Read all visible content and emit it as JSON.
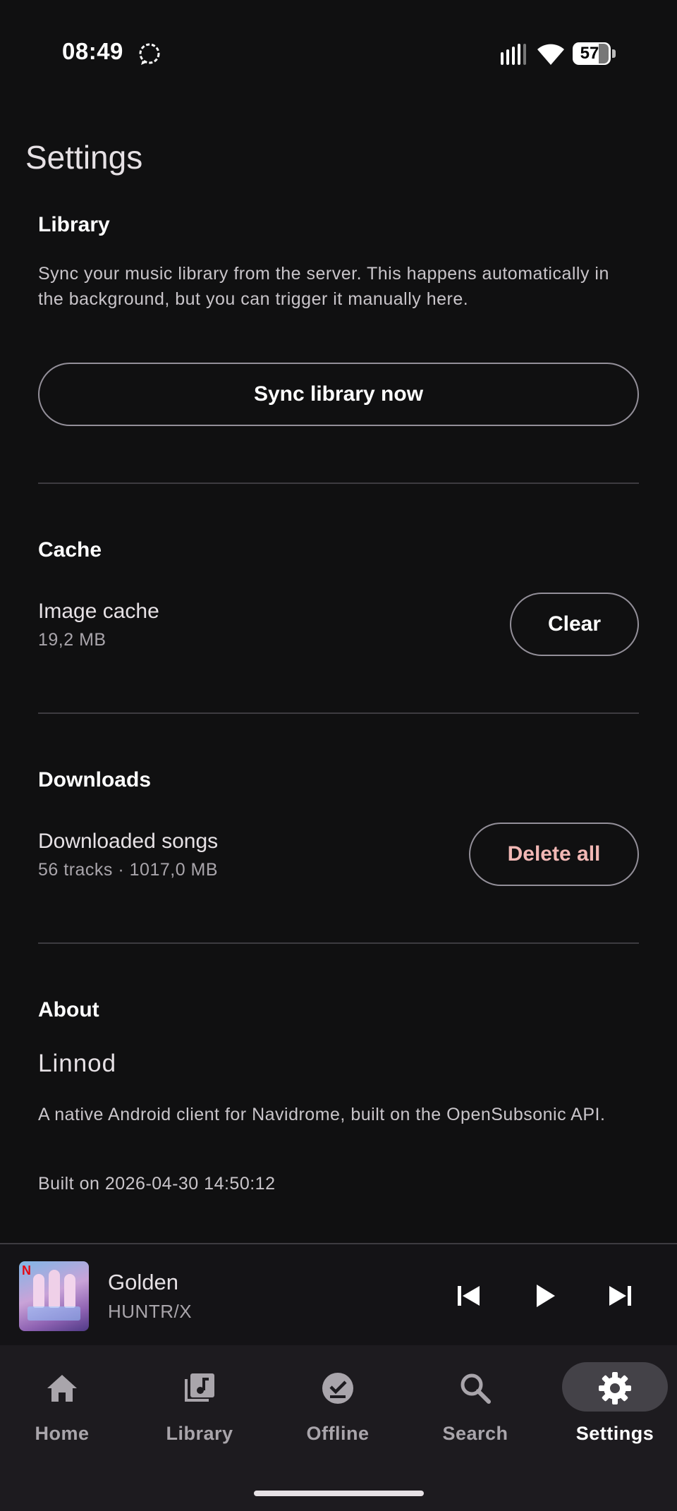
{
  "status_bar": {
    "time": "08:49",
    "battery": "57"
  },
  "page": {
    "title": "Settings"
  },
  "library": {
    "title": "Library",
    "description": "Sync your music library from the server. This happens automatically in the background, but you can trigger it manually here.",
    "sync_button": "Sync library now"
  },
  "cache": {
    "title": "Cache",
    "image_cache_label": "Image cache",
    "image_cache_size": "19,2 MB",
    "clear_button": "Clear"
  },
  "downloads": {
    "title": "Downloads",
    "label": "Downloaded songs",
    "summary": "56 tracks · 1017,0 MB",
    "delete_button": "Delete all"
  },
  "about": {
    "title": "About",
    "app_name": "Linnod",
    "description": "A native Android client for Navidrome, built on the OpenSubsonic API.",
    "build": "Built on 2026-04-30 14:50:12"
  },
  "player": {
    "title": "Golden",
    "artist": "HUNTR/X",
    "album_art_badge": "N",
    "icons": [
      "skip-previous-icon",
      "play-icon",
      "skip-next-icon"
    ]
  },
  "nav": {
    "items": [
      {
        "label": "Home",
        "icon": "home-icon",
        "active": false
      },
      {
        "label": "Library",
        "icon": "library-music-icon",
        "active": false
      },
      {
        "label": "Offline",
        "icon": "offline-check-icon",
        "active": false
      },
      {
        "label": "Search",
        "icon": "search-icon",
        "active": false
      },
      {
        "label": "Settings",
        "icon": "gear-icon",
        "active": true
      }
    ]
  },
  "colors": {
    "background": "#101011",
    "danger_text": "#f2b8b5",
    "active_pill": "#444248",
    "divider": "#3d3b40"
  }
}
